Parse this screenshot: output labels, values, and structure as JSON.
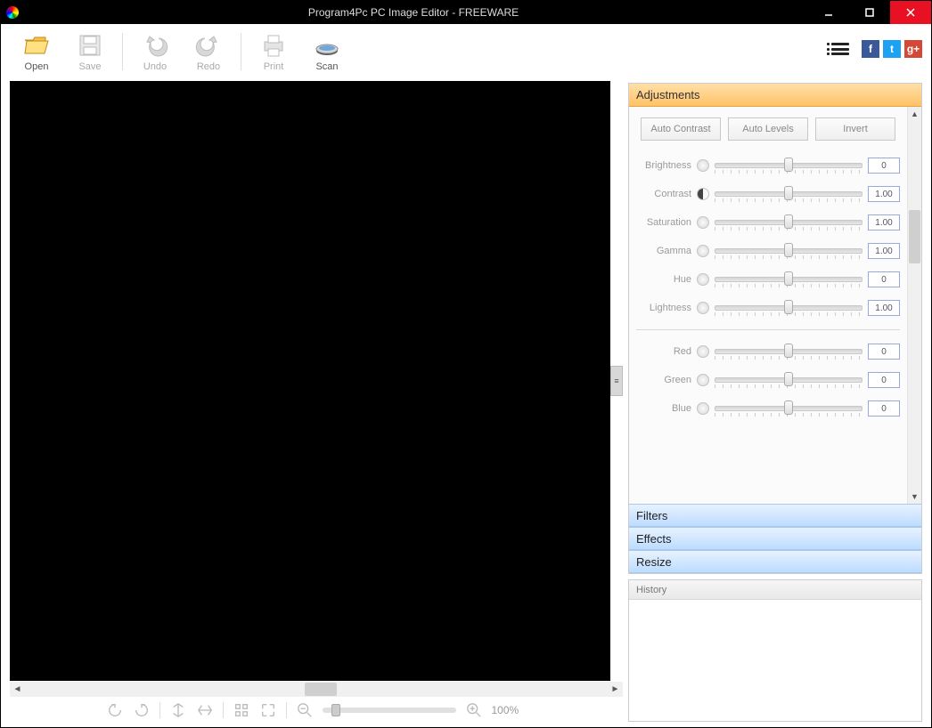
{
  "window": {
    "title": "Program4Pc PC Image Editor - FREEWARE"
  },
  "toolbar": {
    "open": "Open",
    "save": "Save",
    "undo": "Undo",
    "redo": "Redo",
    "print": "Print",
    "scan": "Scan"
  },
  "panels": {
    "adjustments": "Adjustments",
    "filters": "Filters",
    "effects": "Effects",
    "resize": "Resize",
    "history": "History"
  },
  "auto_buttons": {
    "contrast": "Auto Contrast",
    "levels": "Auto Levels",
    "invert": "Invert"
  },
  "sliders": {
    "brightness": {
      "label": "Brightness",
      "value": "0"
    },
    "contrast": {
      "label": "Contrast",
      "value": "1.00"
    },
    "saturation": {
      "label": "Saturation",
      "value": "1.00"
    },
    "gamma": {
      "label": "Gamma",
      "value": "1.00"
    },
    "hue": {
      "label": "Hue",
      "value": "0"
    },
    "lightness": {
      "label": "Lightness",
      "value": "1.00"
    },
    "red": {
      "label": "Red",
      "value": "0"
    },
    "green": {
      "label": "Green",
      "value": "0"
    },
    "blue": {
      "label": "Blue",
      "value": "0"
    }
  },
  "zoom": {
    "percent": "100%"
  },
  "social": {
    "fb": "f",
    "tw": "t",
    "gp": "g+"
  }
}
